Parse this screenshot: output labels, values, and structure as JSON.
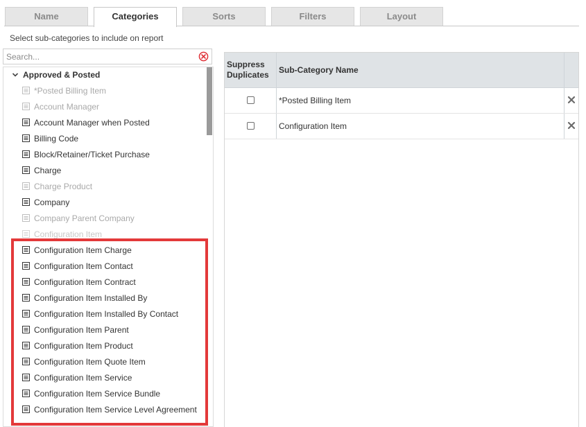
{
  "tabs": [
    {
      "label": "Name",
      "active": false
    },
    {
      "label": "Categories",
      "active": true
    },
    {
      "label": "Sorts",
      "active": false
    },
    {
      "label": "Filters",
      "active": false
    },
    {
      "label": "Layout",
      "active": false
    }
  ],
  "instructions": "Select sub-categories to include on report",
  "search": {
    "placeholder": "Search...",
    "value": "",
    "clear_icon": "clear-circle-icon"
  },
  "tree": {
    "group": {
      "label": "Approved & Posted",
      "expanded": true,
      "icon": "chevron-down-icon"
    },
    "items": [
      {
        "label": "*Posted Billing Item",
        "state": "disabled"
      },
      {
        "label": "Account Manager",
        "state": "disabled"
      },
      {
        "label": "Account Manager when Posted",
        "state": "enabled"
      },
      {
        "label": "Billing Code",
        "state": "enabled"
      },
      {
        "label": "Block/Retainer/Ticket Purchase",
        "state": "enabled"
      },
      {
        "label": "Charge",
        "state": "enabled"
      },
      {
        "label": "Charge Product",
        "state": "disabled"
      },
      {
        "label": "Company",
        "state": "enabled"
      },
      {
        "label": "Company Parent Company",
        "state": "disabled"
      },
      {
        "label": "Configuration Item",
        "state": "faded"
      },
      {
        "label": "Configuration Item Charge",
        "state": "enabled"
      },
      {
        "label": "Configuration Item Contact",
        "state": "enabled"
      },
      {
        "label": "Configuration Item Contract",
        "state": "enabled"
      },
      {
        "label": "Configuration Item Installed By",
        "state": "enabled"
      },
      {
        "label": "Configuration Item Installed By Contact",
        "state": "enabled"
      },
      {
        "label": "Configuration Item Parent",
        "state": "enabled"
      },
      {
        "label": "Configuration Item Product",
        "state": "enabled"
      },
      {
        "label": "Configuration Item Quote Item",
        "state": "enabled"
      },
      {
        "label": "Configuration Item Service",
        "state": "enabled"
      },
      {
        "label": "Configuration Item Service Bundle",
        "state": "enabled"
      },
      {
        "label": "Configuration Item Service Level Agreement",
        "state": "enabled"
      }
    ]
  },
  "grid": {
    "columns": {
      "suppress": "Suppress Duplicates",
      "name": "Sub-Category Name"
    },
    "rows": [
      {
        "name": "*Posted Billing Item",
        "suppress": false
      },
      {
        "name": "Configuration Item",
        "suppress": false
      }
    ]
  },
  "colors": {
    "highlight": "#e3393a",
    "clear_icon": "#e0343a",
    "grid_header": "#dfe3e6",
    "tab_inactive": "#e6e6e6"
  }
}
